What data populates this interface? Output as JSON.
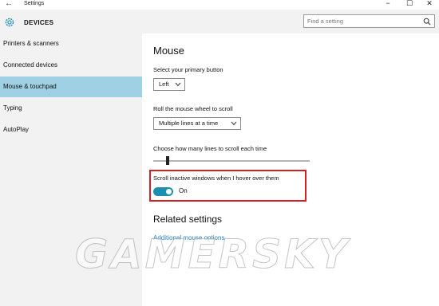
{
  "window": {
    "title": "Settings",
    "back_glyph": "←",
    "minimize_glyph": "−",
    "maximize_glyph": "☐",
    "close_glyph": "✕"
  },
  "sidebar": {
    "section_title": "DEVICES",
    "items": [
      {
        "label": "Printers & scanners",
        "active": false
      },
      {
        "label": "Connected devices",
        "active": false
      },
      {
        "label": "Mouse & touchpad",
        "active": true
      },
      {
        "label": "Typing",
        "active": false
      },
      {
        "label": "AutoPlay",
        "active": false
      }
    ]
  },
  "search": {
    "placeholder": "Find a setting",
    "icon": "search-icon"
  },
  "main": {
    "title": "Mouse",
    "primary_button": {
      "label": "Select your primary button",
      "value": "Left"
    },
    "scroll_mode": {
      "label": "Roll the mouse wheel to scroll",
      "value": "Multiple lines at a time"
    },
    "scroll_lines": {
      "label": "Choose how many lines to scroll each time"
    },
    "inactive_scroll": {
      "label": "Scroll inactive windows when I hover over them",
      "state": "On"
    },
    "related_title": "Related settings",
    "related_link": "Additional mouse options"
  },
  "watermark": "GAMERSKY",
  "colors": {
    "accent": "#1b8fb0",
    "active_nav": "#9fd0e4",
    "highlight_box": "#d42020",
    "link": "#2a7fbf"
  }
}
